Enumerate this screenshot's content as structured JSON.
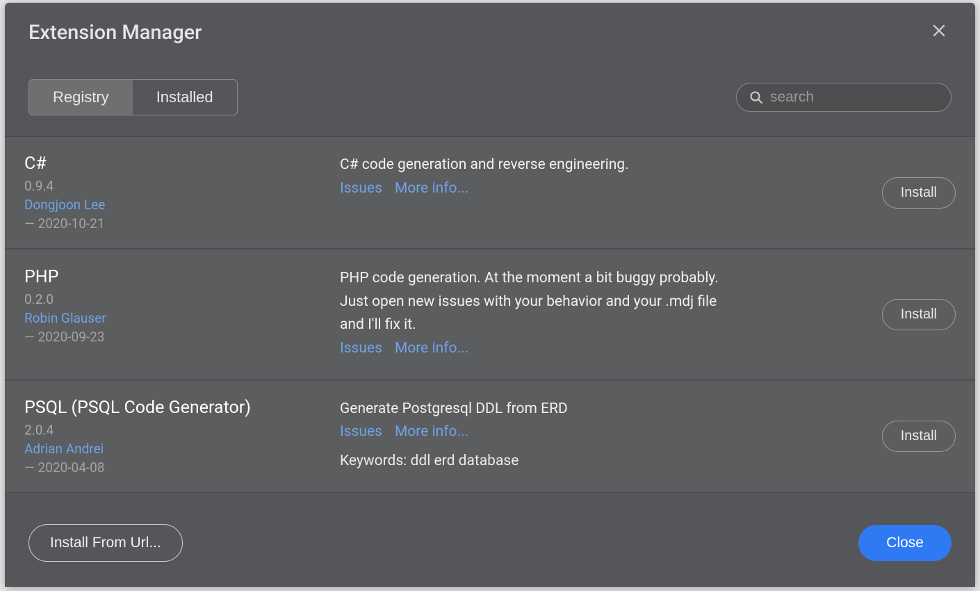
{
  "dialog": {
    "title": "Extension Manager"
  },
  "tabs": {
    "registry": "Registry",
    "installed": "Installed"
  },
  "search": {
    "placeholder": "search"
  },
  "links": {
    "issues": "Issues",
    "more_info": "More info..."
  },
  "buttons": {
    "install": "Install",
    "install_from_url": "Install From Url...",
    "close": "Close"
  },
  "extensions": [
    {
      "name": "C#",
      "version": "0.9.4",
      "author": "Dongjoon Lee",
      "date": "— 2020-10-21",
      "description": "C# code generation and reverse engineering.",
      "keywords": ""
    },
    {
      "name": "PHP",
      "version": "0.2.0",
      "author": "Robin Glauser",
      "date": "— 2020-09-23",
      "description": "PHP code generation. At the moment a bit buggy probably. Just open new issues with your behavior and your .mdj file and I'll fix it.",
      "keywords": ""
    },
    {
      "name": "PSQL (PSQL Code Generator)",
      "version": "2.0.4",
      "author": "Adrian Andrei",
      "date": "— 2020-04-08",
      "description": "Generate Postgresql DDL from ERD",
      "keywords": "Keywords: ddl erd database"
    }
  ]
}
